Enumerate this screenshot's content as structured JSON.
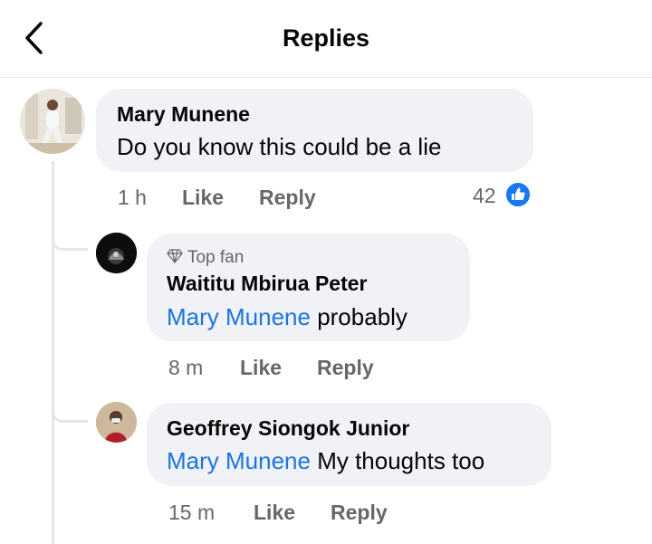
{
  "header": {
    "title": "Replies"
  },
  "colors": {
    "accent": "#1877f2",
    "mention": "#1b74e4",
    "bubble": "#f0f2f5",
    "meta": "#65676b"
  },
  "comment": {
    "author": "Mary Munene",
    "text": "Do you  know  this  could be  a lie",
    "time": "1 h",
    "like_label": "Like",
    "reply_label": "Reply",
    "reaction_count": "42",
    "reaction_icon": "like-thumb-icon"
  },
  "replies": [
    {
      "badge_icon": "diamond-icon",
      "badge": "Top fan",
      "author": "Waititu Mbirua Peter",
      "mention": "Mary Munene",
      "text": " probably",
      "time": "8 m",
      "like_label": "Like",
      "reply_label": "Reply"
    },
    {
      "author": "Geoffrey Siongok Junior",
      "mention": "Mary Munene",
      "text": " My thoughts too",
      "time": "15 m",
      "like_label": "Like",
      "reply_label": "Reply"
    }
  ]
}
